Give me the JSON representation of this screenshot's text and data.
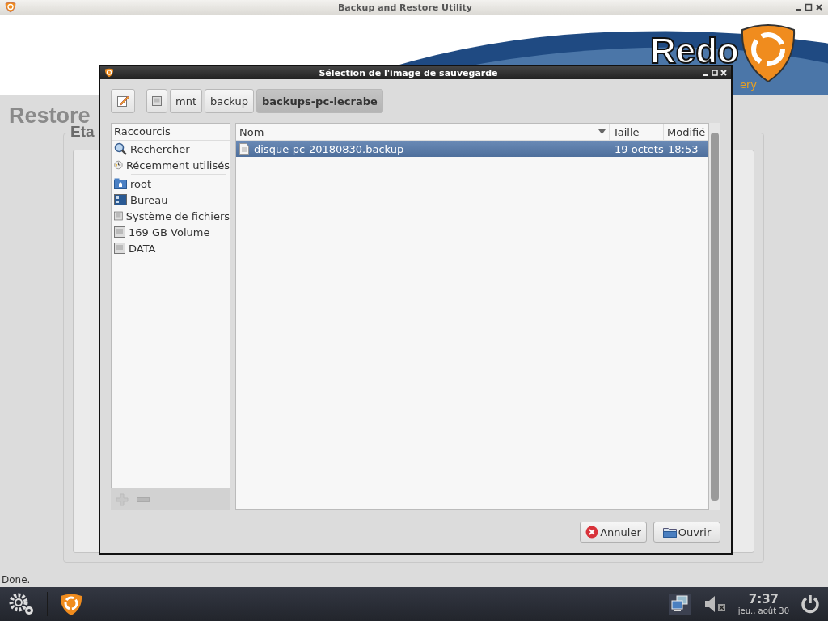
{
  "window": {
    "title": "Backup and Restore Utility"
  },
  "header": {
    "logo_text": "Redo",
    "tagline": "ery"
  },
  "page": {
    "heading": "Restore",
    "group_label": "Eta"
  },
  "status_bar": "Done.",
  "dialog": {
    "title": "Sélection de l'image de sauvegarde",
    "path_buttons": [
      {
        "kind": "drive",
        "selected": false
      },
      {
        "kind": "folder",
        "label": "mnt",
        "selected": false
      },
      {
        "kind": "folder",
        "label": "backup",
        "selected": false
      },
      {
        "kind": "folder",
        "label": "backups-pc-lecrabe",
        "selected": true
      }
    ],
    "places": {
      "header": "Raccourcis",
      "groups": [
        {
          "items": [
            {
              "kind": "search",
              "label": "Rechercher"
            },
            {
              "kind": "recent",
              "label": "Récemment utilisés"
            }
          ]
        },
        {
          "items": [
            {
              "kind": "home",
              "label": "root"
            },
            {
              "kind": "desktop",
              "label": "Bureau"
            },
            {
              "kind": "drive",
              "label": "Système de fichiers"
            },
            {
              "kind": "drive",
              "label": "169 GB Volume"
            },
            {
              "kind": "drive",
              "label": "DATA"
            }
          ]
        }
      ]
    },
    "columns": [
      {
        "label": "Nom",
        "sorted": true
      },
      {
        "label": "Taille",
        "sorted": false
      },
      {
        "label": "Modifié",
        "sorted": false
      }
    ],
    "files": [
      {
        "name": "disque-pc-20180830.backup",
        "size": "19 octets",
        "modified": "18:53",
        "selected": true
      }
    ],
    "buttons": [
      {
        "kind": "cancel",
        "label": "Annuler"
      },
      {
        "kind": "open",
        "label": "Ouvrir"
      }
    ]
  },
  "taskbar": {
    "time": "7:37",
    "date": "jeu., août 30"
  }
}
